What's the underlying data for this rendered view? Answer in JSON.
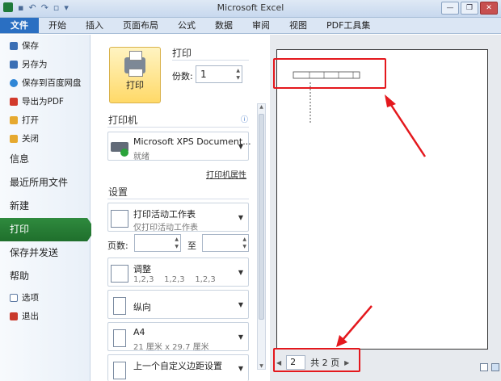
{
  "window": {
    "title": "Microsoft Excel"
  },
  "ribbon": {
    "tabs": [
      "文件",
      "开始",
      "插入",
      "页面布局",
      "公式",
      "数据",
      "审阅",
      "视图",
      "PDF工具集"
    ]
  },
  "sidebar": {
    "small_items": [
      {
        "label": "保存",
        "icon": "save-icon",
        "color": "#3a6fb5"
      },
      {
        "label": "另存为",
        "icon": "save-as-icon",
        "color": "#3a6fb5"
      },
      {
        "label": "保存到百度网盘",
        "icon": "cloud-icon",
        "color": "#2f86d6"
      },
      {
        "label": "导出为PDF",
        "icon": "pdf-icon",
        "color": "#d23a2c"
      },
      {
        "label": "打开",
        "icon": "folder-icon",
        "color": "#e6a92f"
      },
      {
        "label": "关闭",
        "icon": "close-folder-icon",
        "color": "#e6a92f"
      }
    ],
    "big_items": [
      "信息",
      "最近所用文件",
      "新建",
      "打印",
      "保存并发送",
      "帮助"
    ],
    "active": "打印",
    "bottom_items": [
      {
        "label": "选项",
        "icon": "options-icon",
        "color": "#5d7aa3"
      },
      {
        "label": "退出",
        "icon": "exit-icon",
        "color": "#c9392c"
      }
    ]
  },
  "print": {
    "section_title": "打印",
    "button_label": "打印",
    "copies_label": "份数:",
    "copies_value": "1"
  },
  "printer": {
    "section_title": "打印机",
    "name": "Microsoft XPS Document...",
    "status": "就绪",
    "properties_link": "打印机属性"
  },
  "settings": {
    "section_title": "设置",
    "scope": {
      "title": "打印活动工作表",
      "subtitle": "仅打印活动工作表"
    },
    "pages_label": "页数:",
    "to_label": "至",
    "collate": {
      "title": "调整",
      "subtitle": "1,2,3    1,2,3    1,2,3"
    },
    "orientation": {
      "title": "纵向"
    },
    "paper": {
      "title": "A4",
      "subtitle": "21 厘米 x 29.7 厘米"
    },
    "margins": {
      "title": "上一个自定义边距设置"
    }
  },
  "preview": {
    "current_page": "2",
    "total_pages_text": "共 2 页",
    "highlight_color": "#e4181d"
  }
}
